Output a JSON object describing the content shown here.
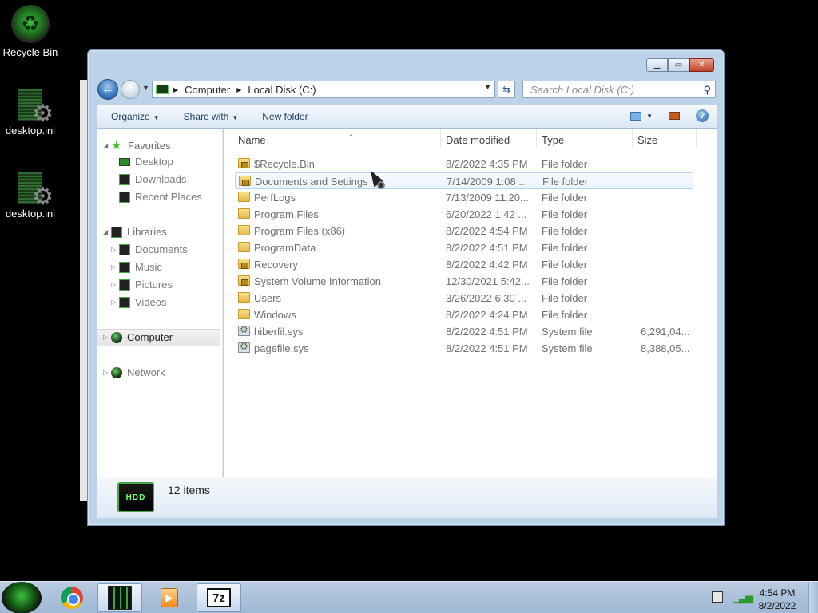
{
  "desktop": {
    "icons": [
      {
        "label": "Recycle Bin",
        "icon": "recycle-bin-icon"
      },
      {
        "label": "desktop.ini",
        "icon": "settings-file-icon"
      },
      {
        "label": "desktop.ini",
        "icon": "settings-file-icon"
      }
    ]
  },
  "window": {
    "address": {
      "crumbs": [
        "Computer",
        "Local Disk (C:)"
      ]
    },
    "search": {
      "placeholder": "Search Local Disk (C:)"
    },
    "toolbar": {
      "organize": "Organize",
      "share_with": "Share with",
      "new_folder": "New folder"
    },
    "navpane": {
      "favorites": "Favorites",
      "desktop": "Desktop",
      "downloads": "Downloads",
      "recent": "Recent Places",
      "libraries": "Libraries",
      "documents": "Documents",
      "music": "Music",
      "pictures": "Pictures",
      "videos": "Videos",
      "computer": "Computer",
      "network": "Network"
    },
    "columns": {
      "name": "Name",
      "date": "Date modified",
      "type": "Type",
      "size": "Size"
    },
    "files": [
      {
        "name": "$Recycle.Bin",
        "date": "8/2/2022 4:35 PM",
        "type": "File folder",
        "size": "",
        "icon": "locked-folder"
      },
      {
        "name": "Documents and Settings",
        "date": "7/14/2009 1:08 ...",
        "type": "File folder",
        "size": "",
        "icon": "locked-folder"
      },
      {
        "name": "PerfLogs",
        "date": "7/13/2009 11:20...",
        "type": "File folder",
        "size": "",
        "icon": "folder"
      },
      {
        "name": "Program Files",
        "date": "6/20/2022 1:42 ...",
        "type": "File folder",
        "size": "",
        "icon": "folder"
      },
      {
        "name": "Program Files (x86)",
        "date": "8/2/2022 4:54 PM",
        "type": "File folder",
        "size": "",
        "icon": "folder"
      },
      {
        "name": "ProgramData",
        "date": "8/2/2022 4:51 PM",
        "type": "File folder",
        "size": "",
        "icon": "folder"
      },
      {
        "name": "Recovery",
        "date": "8/2/2022 4:42 PM",
        "type": "File folder",
        "size": "",
        "icon": "locked-folder"
      },
      {
        "name": "System Volume Information",
        "date": "12/30/2021 5:42...",
        "type": "File folder",
        "size": "",
        "icon": "locked-folder"
      },
      {
        "name": "Users",
        "date": "3/26/2022 6:30 ...",
        "type": "File folder",
        "size": "",
        "icon": "folder"
      },
      {
        "name": "Windows",
        "date": "8/2/2022 4:24 PM",
        "type": "File folder",
        "size": "",
        "icon": "folder"
      },
      {
        "name": "hiberfil.sys",
        "date": "8/2/2022 4:51 PM",
        "type": "System file",
        "size": "6,291,04...",
        "icon": "system-file"
      },
      {
        "name": "pagefile.sys",
        "date": "8/2/2022 4:51 PM",
        "type": "System file",
        "size": "8,388,05...",
        "icon": "system-file"
      }
    ],
    "status": {
      "item_count": "12 items",
      "drive_icon_text": "HDD"
    }
  },
  "taskbar": {
    "apps": [
      "start-orb",
      "chrome",
      "explorer",
      "media-player",
      "7-zip"
    ],
    "zip_label": "7z",
    "clock": {
      "time": "4:54 PM",
      "date": "8/2/2022"
    }
  }
}
